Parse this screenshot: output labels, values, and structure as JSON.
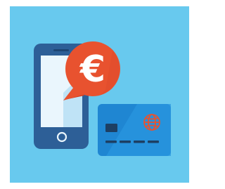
{
  "illustration": {
    "background_color": "#68c9ee",
    "phone": {
      "body_color": "#2d5f97",
      "screen_color": "#eaf6fd",
      "screen_highlight_color": "#bfe3f6"
    },
    "bubble": {
      "symbol": "€",
      "fill_color": "#e8522f",
      "shadow_color": "#cf4022",
      "symbol_color": "#ffffff"
    },
    "card": {
      "fill_color": "#1f86d2",
      "shine_color": "#2a97e0",
      "chip_color": "#1d3f63",
      "stripe_color": "#1d3f63",
      "globe_icon": "globe-icon",
      "globe_color": "#e8522f"
    }
  }
}
